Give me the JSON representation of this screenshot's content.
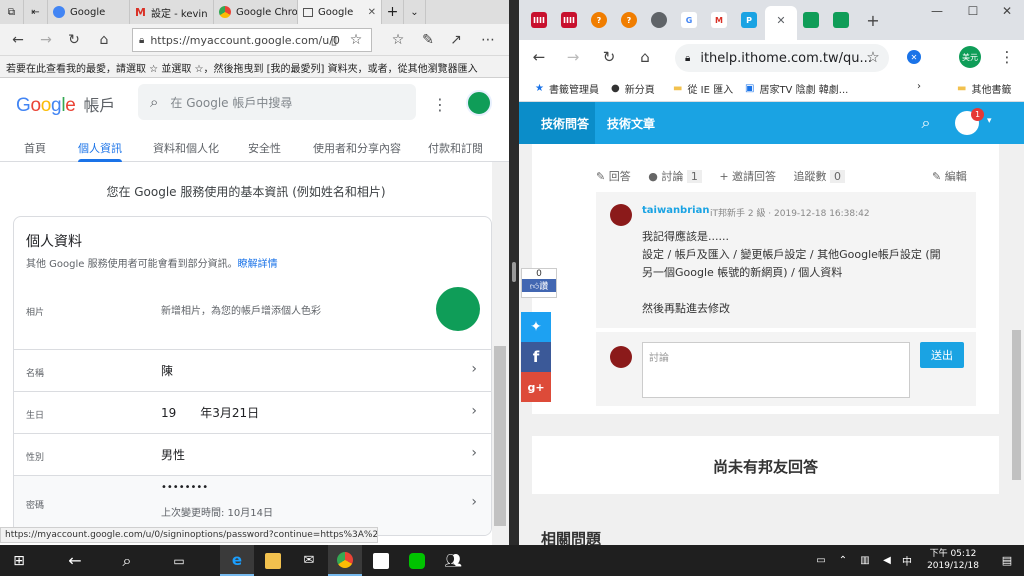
{
  "edge": {
    "tabs": [
      {
        "label": "Google"
      },
      {
        "label": "設定 - kevin"
      },
      {
        "label": "Google Chro"
      },
      {
        "label": "Google"
      }
    ],
    "url": "https://myaccount.google.com/u/0",
    "favbar_text": "若要在此查看我的最愛，請選取 ☆ 並選取 ☆，然後拖曳到 [我的最愛列] 資料夾，或者，從其他瀏覽器匯入",
    "status_url": "https://myaccount.google.com/u/0/signinoptions/password?continue=https%3A%2F%2Fmya"
  },
  "google": {
    "logo": {
      "G": "G",
      "o1": "o",
      "o2": "o",
      "g": "g",
      "l": "l",
      "e": "e",
      "suffix": "帳戶"
    },
    "search_placeholder": "在 Google 帳戶中搜尋",
    "tabs": [
      "首頁",
      "個人資訊",
      "資料和個人化",
      "安全性",
      "使用者和分享內容",
      "付款和訂閱"
    ],
    "page_desc": "您在 Google 服務使用的基本資訊 (例如姓名和相片)",
    "card_title": "個人資料",
    "card_subtitle": "其他 Google 服務使用者可能會看到部分資訊。",
    "learn_more": "瞭解詳情",
    "rows": [
      {
        "label": "相片",
        "value": "新增相片，為您的帳戶增添個人色彩"
      },
      {
        "label": "名稱",
        "value": "陳"
      },
      {
        "label": "生日",
        "value": "19　　年3月21日"
      },
      {
        "label": "性別",
        "value": "男性"
      },
      {
        "label": "密碼",
        "value": "••••••••",
        "sub": "上次變更時間: 10月14日"
      }
    ]
  },
  "chrome": {
    "url": "ithelp.ithome.com.tw/qu...",
    "profile_label": "美元",
    "bookmarks": [
      "書籤管理員",
      "新分頁",
      "從 IE 匯入",
      "居家TV 陰劇 韓劇...",
      "其他書籤"
    ]
  },
  "ithelp": {
    "nav": [
      "技術問答",
      "技術文章"
    ],
    "notif_count": "1",
    "actions": {
      "reply": "回答",
      "discuss": "討論",
      "discuss_count": "1",
      "invite": "邀請回答",
      "follow": "追蹤數",
      "follow_count": "0",
      "edit": "編輯"
    },
    "comment": {
      "user": "taiwanbrian",
      "meta": "iT邦新手 2 級 · 2019-12-18 16:38:42",
      "lines": [
        "我記得應該是......",
        "設定 / 帳戶及匯入 / 變更帳戶設定 / 其他Google帳戶設定 (開",
        "另一個Google 帳號的新網頁) / 個人資料",
        "",
        "然後再點進去修改"
      ]
    },
    "discuss_placeholder": "討論",
    "send_label": "送出",
    "no_answer": "尚未有邦友回答",
    "related": "相關問題",
    "share": {
      "like_count": "0",
      "like_label": "讚"
    }
  },
  "taskbar": {
    "time": "下午 05:12",
    "date": "2019/12/18"
  },
  "colors": {
    "google_blue": "#1a73e8",
    "ithelp_blue": "#1aa3e3",
    "taskbar": "#1f1f1f"
  }
}
